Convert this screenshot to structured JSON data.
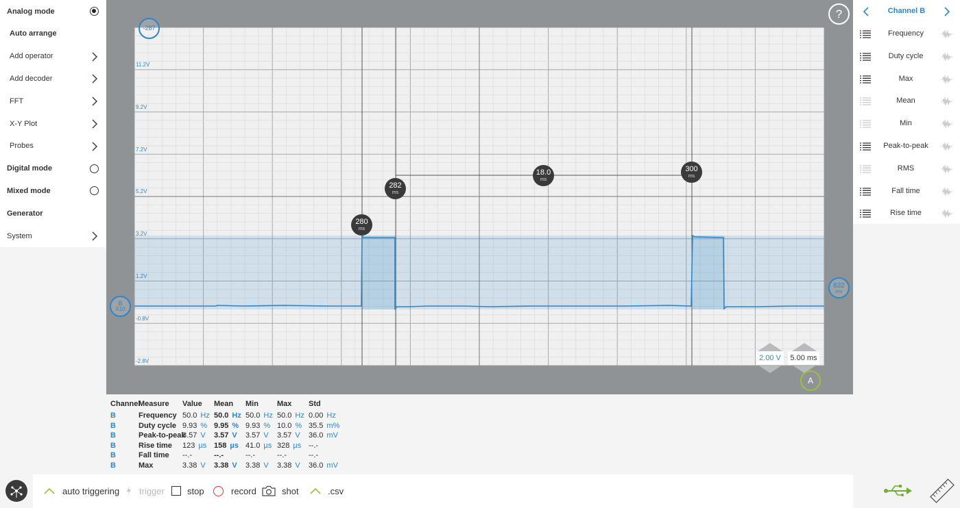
{
  "left_menu": {
    "items": [
      {
        "label": "Analog mode",
        "style": "bold",
        "control": "radio-on"
      },
      {
        "label": "Auto arrange",
        "style": "bold-sub",
        "control": "none"
      },
      {
        "label": "Add operator",
        "style": "sub",
        "control": "chevron"
      },
      {
        "label": "Add decoder",
        "style": "sub",
        "control": "chevron"
      },
      {
        "label": "FFT",
        "style": "sub",
        "control": "chevron"
      },
      {
        "label": "X-Y Plot",
        "style": "sub",
        "control": "chevron"
      },
      {
        "label": "Probes",
        "style": "sub",
        "control": "chevron"
      },
      {
        "label": "Digital mode",
        "style": "bold",
        "control": "radio-off"
      },
      {
        "label": "Mixed mode",
        "style": "bold",
        "control": "radio-off"
      },
      {
        "label": "Generator",
        "style": "bold",
        "control": "none"
      },
      {
        "label": "System",
        "style": "normal",
        "control": "chevron"
      }
    ]
  },
  "scope": {
    "y_labels": [
      "11.2V",
      "9.2V",
      "7.2V",
      "5.2V",
      "3.2V",
      "1.2V",
      "-0.8V",
      "-2.8V"
    ],
    "top_marker": "-287",
    "channel_marker": {
      "line1": "B",
      "line2": "X10"
    },
    "right_marker": {
      "value": "832",
      "unit": "mV"
    },
    "trigger_marker": "A",
    "help_label": "?",
    "cursors": [
      {
        "value": "280",
        "unit": "ms"
      },
      {
        "value": "282",
        "unit": "ms"
      },
      {
        "value": "18.0",
        "unit": "ms"
      },
      {
        "value": "300",
        "unit": "ms"
      }
    ],
    "volt_scale": "2.00 V",
    "time_scale": "5.00 ms"
  },
  "right_panel": {
    "title": "Channel B",
    "items": [
      {
        "label": "Frequency",
        "active": true
      },
      {
        "label": "Duty cycle",
        "active": true
      },
      {
        "label": "Max",
        "active": true
      },
      {
        "label": "Mean",
        "active": false
      },
      {
        "label": "Min",
        "active": false
      },
      {
        "label": "Peak-to-peak",
        "active": true
      },
      {
        "label": "RMS",
        "active": false
      },
      {
        "label": "Fall time",
        "active": true
      },
      {
        "label": "Rise time",
        "active": true
      }
    ]
  },
  "measurements": {
    "headers": [
      "Channel",
      "Measure",
      "Value",
      "Mean",
      "Min",
      "Max",
      "Std"
    ],
    "rows": [
      {
        "channel": "B",
        "measure": "Frequency",
        "value": "50.0",
        "value_unit": "Hz",
        "mean": "50.0",
        "mean_unit": "Hz",
        "min": "50.0",
        "min_unit": "Hz",
        "max": "50.0",
        "max_unit": "Hz",
        "std": "0.00",
        "std_unit": "Hz"
      },
      {
        "channel": "B",
        "measure": "Duty cycle",
        "value": "9.93",
        "value_unit": "%",
        "mean": "9.95",
        "mean_unit": "%",
        "min": "9.93",
        "min_unit": "%",
        "max": "10.0",
        "max_unit": "%",
        "std": "35.5",
        "std_unit": "m%"
      },
      {
        "channel": "B",
        "measure": "Peak-to-peak",
        "value": "3.57",
        "value_unit": "V",
        "mean": "3.57",
        "mean_unit": "V",
        "min": "3.57",
        "min_unit": "V",
        "max": "3.57",
        "max_unit": "V",
        "std": "36.0",
        "std_unit": "mV"
      },
      {
        "channel": "B",
        "measure": "Rise time",
        "value": "123",
        "value_unit": "µs",
        "mean": "158",
        "mean_unit": "µs",
        "min": "41.0",
        "min_unit": "µs",
        "max": "328",
        "max_unit": "µs",
        "std": "--.-",
        "std_unit": ""
      },
      {
        "channel": "B",
        "measure": "Fall time",
        "value": "--.-",
        "value_unit": "",
        "mean": "--.-",
        "mean_unit": "",
        "min": "--.-",
        "min_unit": "",
        "max": "--.-",
        "max_unit": "",
        "std": "--.-",
        "std_unit": ""
      },
      {
        "channel": "B",
        "measure": "Max",
        "value": "3.38",
        "value_unit": "V",
        "mean": "3.38",
        "mean_unit": "V",
        "min": "3.38",
        "min_unit": "V",
        "max": "3.38",
        "max_unit": "V",
        "std": "36.0",
        "std_unit": "mV"
      }
    ]
  },
  "bottom_bar": {
    "auto_triggering": "auto triggering",
    "trigger": "trigger",
    "stop": "stop",
    "record": "record",
    "shot": "shot",
    "csv": ".csv"
  },
  "colors": {
    "accent": "#2e86c8",
    "trigger_ring": "#9bc13c",
    "scope_bg": "#8f9396",
    "plot_bg": "#f0f0f0"
  }
}
